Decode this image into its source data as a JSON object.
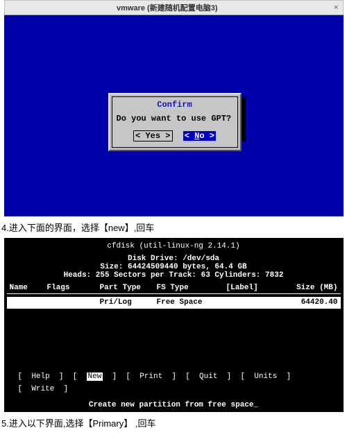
{
  "win1": {
    "titlebar": "vmware (新建随机配置电脑3)"
  },
  "dialog": {
    "title": "Confirm",
    "message": "Do you want to use GPT?",
    "yes": "< Yes >",
    "no_prefix": "< ",
    "no_underline": "N",
    "no_rest": "o  >"
  },
  "caption4": "4.进入下面的界面，选择【new】,回车",
  "caption5": "5.进入以下界面,选择【Primary】 ,回车",
  "cfdisk": {
    "program": "cfdisk (util-linux-ng 2.14.1)",
    "drive": "Disk Drive: /dev/sda",
    "size": "Size: 64424509440 bytes, 64.4 GB",
    "geom": "Heads: 255   Sectors per Track: 63   Cylinders: 7832",
    "hdr": {
      "name": "Name",
      "flags": "Flags",
      "ptype": "Part Type",
      "fstype": "FS Type",
      "label": "[Label]",
      "size": "Size (MB)"
    },
    "row": {
      "ptype": "Pri/Log",
      "fstype": "Free Space",
      "size": "64420.40"
    },
    "menu": {
      "help": "Help",
      "new": "New",
      "print": "Print",
      "quit": "Quit",
      "units": "Units",
      "write": "Write"
    },
    "hint": "Create new partition from free space_"
  },
  "chart_data": {
    "type": "table",
    "title": "cfdisk partition table for /dev/sda",
    "columns": [
      "Name",
      "Flags",
      "Part Type",
      "FS Type",
      "[Label]",
      "Size (MB)"
    ],
    "rows": [
      [
        "",
        "",
        "Pri/Log",
        "Free Space",
        "",
        64420.4
      ]
    ],
    "disk": {
      "device": "/dev/sda",
      "size_bytes": 64424509440,
      "size_human": "64.4 GB",
      "heads": 255,
      "sectors_per_track": 63,
      "cylinders": 7832
    }
  }
}
